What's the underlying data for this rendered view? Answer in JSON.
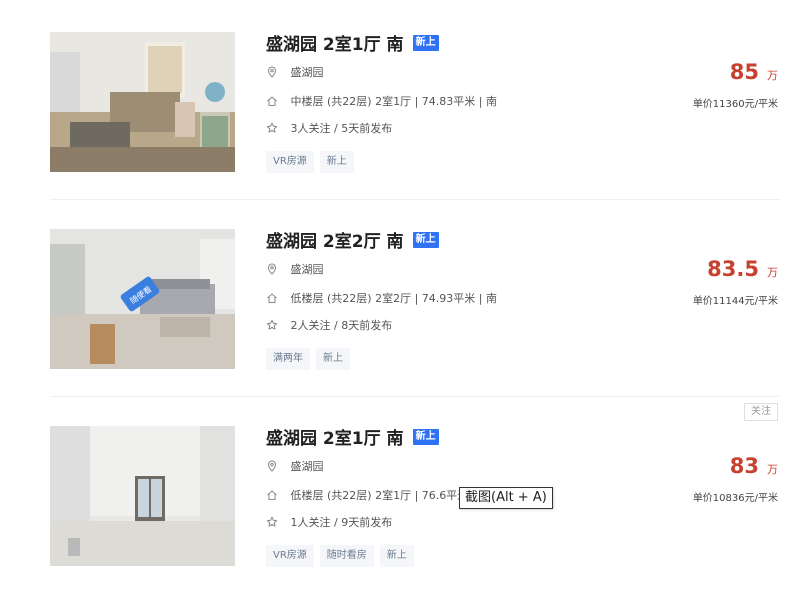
{
  "colors": {
    "price": "#c8402e",
    "new_badge": "#3072f6",
    "tag_bg": "#f4f6f9",
    "tag_text": "#6d7c8f"
  },
  "icons": {
    "location": "location-pin-icon",
    "house": "house-icon",
    "star": "star-icon"
  },
  "listings": [
    {
      "title": "盛湖园 2室1厅 南",
      "badge": "新上",
      "community": "盛湖园",
      "info": "中楼层 (共22层) 2室1厅 | 74.83平米 | 南",
      "follow": "3人关注 / 5天前发布",
      "tags": [
        "VR房源",
        "新上"
      ],
      "price": "85",
      "price_unit": "万",
      "unit_price": "单价11360元/平米"
    },
    {
      "title": "盛湖园 2室2厅 南",
      "badge": "新上",
      "community": "盛湖园",
      "info": "低楼层 (共22层) 2室2厅 | 74.93平米 | 南",
      "follow": "2人关注 / 8天前发布",
      "tags": [
        "满两年",
        "新上"
      ],
      "price": "83.5",
      "price_unit": "万",
      "unit_price": "单价11144元/平米",
      "thumb_sign": "随便看"
    },
    {
      "title": "盛湖园 2室1厅 南",
      "badge": "新上",
      "community": "盛湖园",
      "info": "低楼层 (共22层) 2室1厅 | 76.6平米",
      "follow": "1人关注 / 9天前发布",
      "tags": [
        "VR房源",
        "随时看房",
        "新上"
      ],
      "price": "83",
      "price_unit": "万",
      "unit_price": "单价10836元/平米",
      "follow_button": "关注"
    }
  ],
  "tooltip": "截图(Alt + A)"
}
